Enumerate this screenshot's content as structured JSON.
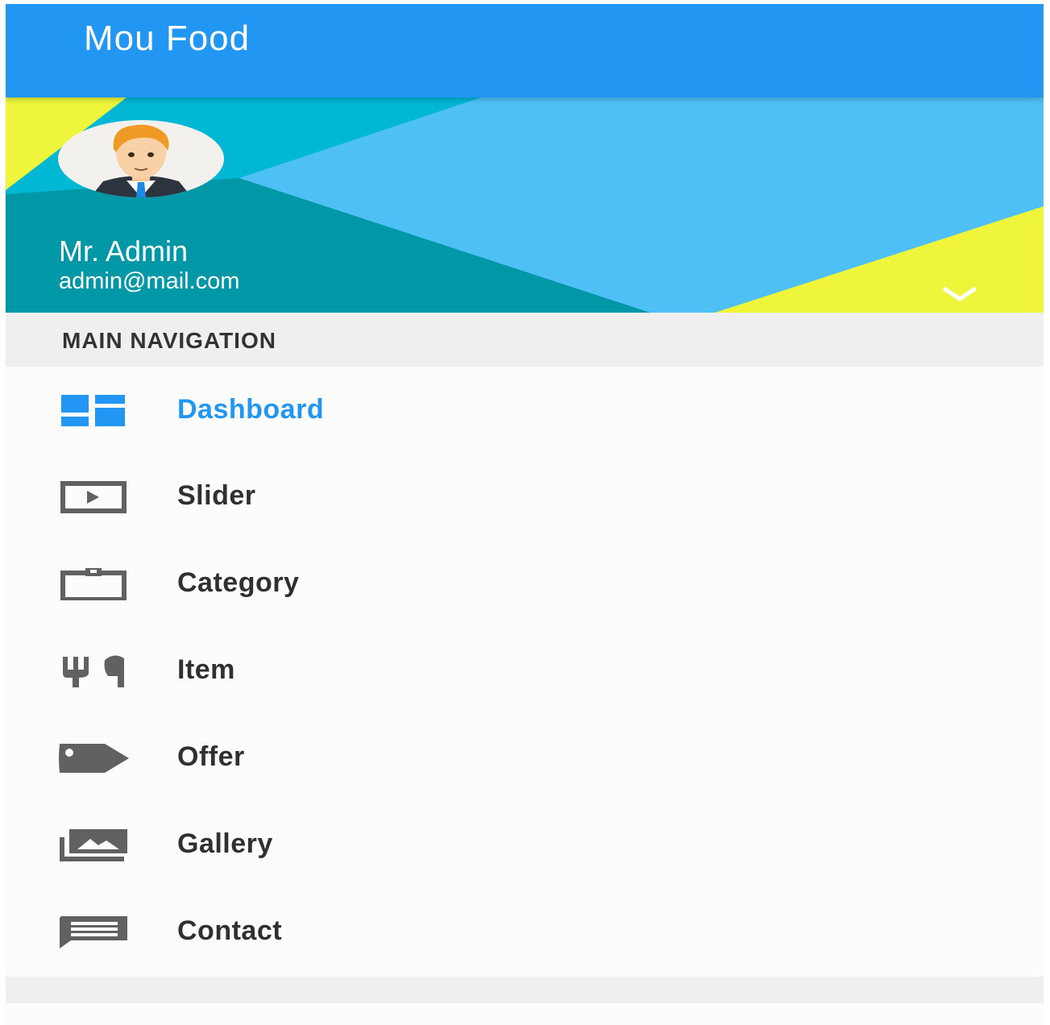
{
  "app_bar": {
    "title": "Mou Food"
  },
  "profile": {
    "name": "Mr. Admin",
    "email": "admin@mail.com",
    "toggle_icon": "chevron-down-icon"
  },
  "navigation": {
    "section_label": "MAIN NAVIGATION",
    "items": [
      {
        "label": "Dashboard",
        "icon": "dashboard-icon",
        "active": true
      },
      {
        "label": "Slider",
        "icon": "slideshow-icon",
        "active": false
      },
      {
        "label": "Category",
        "icon": "clipboard-icon",
        "active": false
      },
      {
        "label": "Item",
        "icon": "restaurant-icon",
        "active": false
      },
      {
        "label": "Offer",
        "icon": "tag-icon",
        "active": false
      },
      {
        "label": "Gallery",
        "icon": "photo-library-icon",
        "active": false
      },
      {
        "label": "Contact",
        "icon": "message-icon",
        "active": false
      }
    ]
  },
  "colors": {
    "primary": "#2196f3",
    "header_light_blue": "#4fc0f5",
    "header_cyan": "#00b7d4",
    "header_teal": "#0097a7",
    "header_lime": "#eef53a",
    "icon_gray": "#616161",
    "section_background": "#efefef"
  }
}
